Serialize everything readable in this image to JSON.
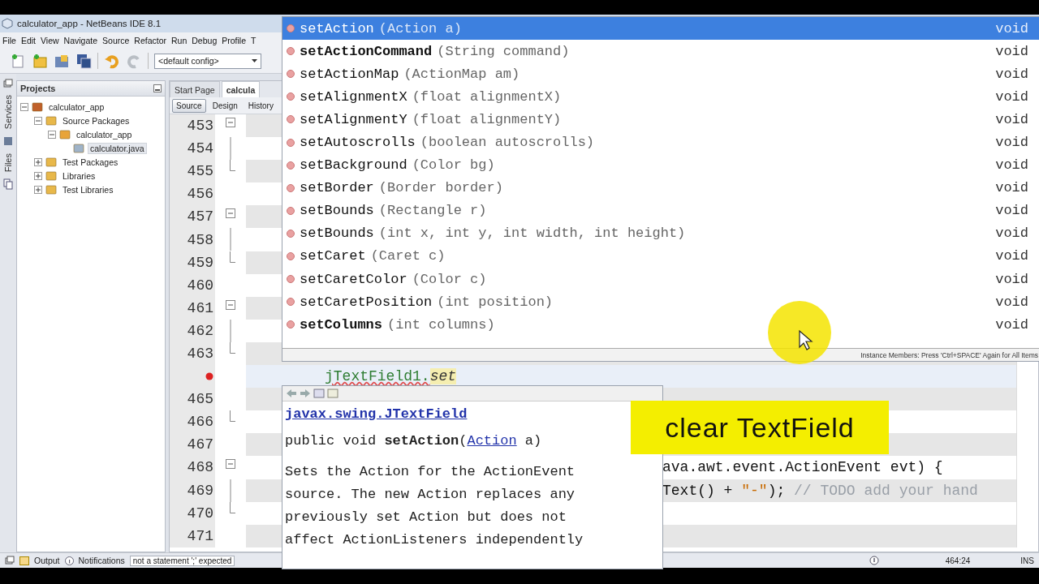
{
  "window": {
    "title": "calculator_app - NetBeans IDE 8.1"
  },
  "menu": [
    "File",
    "Edit",
    "View",
    "Navigate",
    "Source",
    "Refactor",
    "Run",
    "Debug",
    "Profile",
    "T"
  ],
  "toolbar": {
    "config": "<default config>"
  },
  "side_strip": [
    "Services",
    "Files"
  ],
  "projects": {
    "title": "Projects",
    "tree": [
      {
        "label": "calculator_app",
        "kind": "project",
        "expanded": true,
        "children": [
          {
            "label": "Source Packages",
            "kind": "folder",
            "expanded": true,
            "children": [
              {
                "label": "calculator_app",
                "kind": "package",
                "expanded": true,
                "children": [
                  {
                    "label": "calculator.java",
                    "kind": "file",
                    "selected": true
                  }
                ]
              }
            ]
          },
          {
            "label": "Test Packages",
            "kind": "folder",
            "expanded": false
          },
          {
            "label": "Libraries",
            "kind": "folder",
            "expanded": false
          },
          {
            "label": "Test Libraries",
            "kind": "folder",
            "expanded": false
          }
        ]
      }
    ]
  },
  "editor": {
    "tabs": [
      {
        "label": "Start Page",
        "selected": false
      },
      {
        "label": "calcula",
        "selected": true
      }
    ],
    "views": [
      {
        "label": "Source",
        "selected": true
      },
      {
        "label": "Design",
        "selected": false
      },
      {
        "label": "History",
        "selected": false
      }
    ],
    "lines": [
      {
        "number": "453",
        "kind": "fold_start"
      },
      {
        "number": "454",
        "kind": "fold_mid"
      },
      {
        "number": "455",
        "kind": "fold_end"
      },
      {
        "number": "456",
        "kind": "plain"
      },
      {
        "number": "457",
        "kind": "fold_start"
      },
      {
        "number": "458",
        "kind": "fold_mid"
      },
      {
        "number": "459",
        "kind": "fold_end"
      },
      {
        "number": "460",
        "kind": "plain"
      },
      {
        "number": "461",
        "kind": "fold_start"
      },
      {
        "number": "462",
        "kind": "fold_mid"
      },
      {
        "number": "463",
        "kind": "fold_end"
      },
      {
        "kind": "error",
        "current": true,
        "code": "jTextField1.",
        "typed": "set"
      },
      {
        "number": "465",
        "kind": "plain"
      },
      {
        "number": "466",
        "kind": "fold_end"
      },
      {
        "number": "467",
        "kind": "plain"
      },
      {
        "number": "468",
        "kind": "fold_start",
        "code": "ava.awt.event.ActionEvent evt) {",
        "clipped_left": true
      },
      {
        "number": "469",
        "kind": "fold_mid",
        "code": "Text() + ",
        "string": "\"-\"",
        "rest": "); ",
        "comment": "// TODO add your hand",
        "clipped_left": true
      },
      {
        "number": "470",
        "kind": "fold_end"
      },
      {
        "number": "471",
        "kind": "plain"
      }
    ]
  },
  "completion": {
    "items": [
      {
        "name": "setAction",
        "args": "(Action a)",
        "type": "void",
        "selected": true,
        "own": false
      },
      {
        "name": "setActionCommand",
        "args": "(String command)",
        "type": "void",
        "selected": false,
        "own": true
      },
      {
        "name": "setActionMap",
        "args": "(ActionMap am)",
        "type": "void",
        "selected": false,
        "own": false
      },
      {
        "name": "setAlignmentX",
        "args": "(float alignmentX)",
        "type": "void",
        "selected": false,
        "own": false
      },
      {
        "name": "setAlignmentY",
        "args": "(float alignmentY)",
        "type": "void",
        "selected": false,
        "own": false
      },
      {
        "name": "setAutoscrolls",
        "args": "(boolean autoscrolls)",
        "type": "void",
        "selected": false,
        "own": false
      },
      {
        "name": "setBackground",
        "args": "(Color bg)",
        "type": "void",
        "selected": false,
        "own": false
      },
      {
        "name": "setBorder",
        "args": "(Border border)",
        "type": "void",
        "selected": false,
        "own": false
      },
      {
        "name": "setBounds",
        "args": "(Rectangle r)",
        "type": "void",
        "selected": false,
        "own": false
      },
      {
        "name": "setBounds",
        "args": "(int x, int y, int width, int height)",
        "type": "void",
        "selected": false,
        "own": false
      },
      {
        "name": "setCaret",
        "args": "(Caret c)",
        "type": "void",
        "selected": false,
        "own": false
      },
      {
        "name": "setCaretColor",
        "args": "(Color c)",
        "type": "void",
        "selected": false,
        "own": false
      },
      {
        "name": "setCaretPosition",
        "args": "(int position)",
        "type": "void",
        "selected": false,
        "own": false
      },
      {
        "name": "setColumns",
        "args": "(int columns)",
        "type": "void",
        "selected": false,
        "own": true
      }
    ],
    "hint": "Instance Members: Press 'Ctrl+SPACE' Again for All Items"
  },
  "doc": {
    "class_link": "javax.swing.JTextField",
    "signature_prefix": "public void **setAction**(",
    "signature_link": "Action",
    "signature_suffix": " a)",
    "description": "Sets the Action for the ActionEvent source. The new Action replaces any previously set Action but does not affect ActionListeners independently"
  },
  "caption": "clear TextField",
  "status_bar": {
    "tabs": [
      "Output",
      "Notifications"
    ],
    "message": "not a statement ';' expected",
    "position": "464:24",
    "mode": "INS"
  }
}
